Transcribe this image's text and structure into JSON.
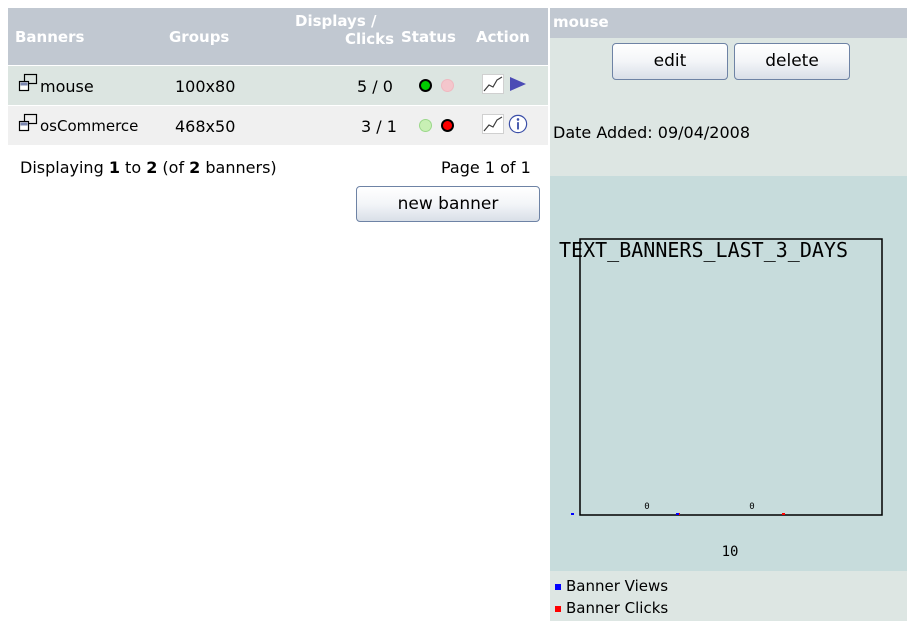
{
  "table": {
    "headers": {
      "banners": "Banners",
      "groups": "Groups",
      "displays_line1": "Displays /",
      "displays_line2": "Clicks",
      "status": "Status",
      "action": "Action"
    },
    "rows": [
      {
        "name": "mouse",
        "group": "100x80",
        "stats": "5 / 0",
        "status": "active",
        "action": "select-arrow-icon"
      },
      {
        "name": "osCommerce",
        "group": "468x50",
        "stats": "3 / 1",
        "status": "inactive",
        "action": "info-icon"
      }
    ],
    "footer": {
      "prefix": "Displaying ",
      "from": "1",
      "to_word": " to ",
      "to": "2",
      "of_open": " (of ",
      "total": "2",
      "suffix": " banners)"
    },
    "page_label": "Page 1 of 1",
    "new_banner_label": "new banner"
  },
  "panel": {
    "title": "mouse",
    "edit_label": "edit",
    "delete_label": "delete",
    "date_added": "Date Added: 09/04/2008",
    "chart_title": "TEXT_BANNERS_LAST_3_DAYS",
    "x_label": "10",
    "legend": [
      {
        "label": "Banner Views",
        "color": "#0000ff"
      },
      {
        "label": "Banner Clicks",
        "color": "#ff0000"
      }
    ]
  },
  "chart_data": {
    "type": "bar",
    "title": "TEXT_BANNERS_LAST_3_DAYS",
    "categories": [
      "",
      "10"
    ],
    "series": [
      {
        "name": "Banner Views",
        "values": [
          0,
          0
        ]
      },
      {
        "name": "Banner Clicks",
        "values": [
          0,
          0
        ]
      }
    ],
    "data_labels": [
      "0",
      "0"
    ],
    "tick_labels": [
      "10"
    ],
    "legend": "bottom-left"
  },
  "colors": {
    "header_bg": "#c1c8d1",
    "row1_bg": "#dce5e1",
    "row2_bg": "#f0f0f0",
    "active_green": "#00cc00",
    "inactive_red": "#ff0000",
    "graph_bg": "#c7dcdc",
    "action_arrow": "#4b4bb5"
  },
  "icons": {
    "banner": "banner-preview-icon",
    "statistics": "statistics-icon",
    "select_arrow": "select-arrow-icon",
    "info": "info-icon"
  }
}
